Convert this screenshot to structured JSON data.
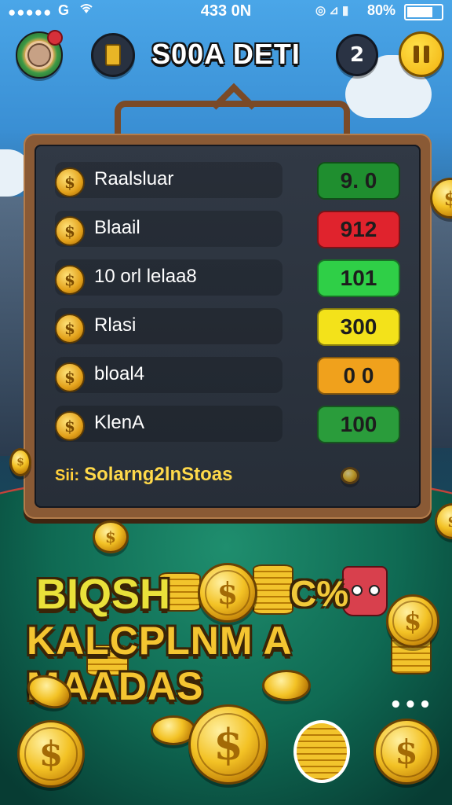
{
  "status_bar": {
    "signal": "●●●●●",
    "carrier_icon": "G",
    "wifi_icon": "wifi-icon",
    "time": "433 0N",
    "right_icons": "◎ ⊿ ▮",
    "battery_pct": "80%",
    "battery_level": 0.8
  },
  "header": {
    "title": "S00A DETI",
    "friends_label": "2",
    "avatar_icon": "avatar-icon",
    "card_icon": "card-icon",
    "pause_icon": "pause-icon"
  },
  "board": {
    "rows": [
      {
        "coin": "$",
        "label": "Raalsluar",
        "value": "9. 0",
        "color": "#1f8e2f"
      },
      {
        "coin": "$",
        "label": "Blaail",
        "value": "912",
        "color": "#e0232d"
      },
      {
        "coin": "$",
        "label": "10 orl lelaa8",
        "value": "101",
        "color": "#2fcf47"
      },
      {
        "coin": "$",
        "label": "Rlasi",
        "value": "300",
        "color": "#f3e21a"
      },
      {
        "coin": "$",
        "label": "bloal4",
        "value": "0 0",
        "color": "#f0a11c"
      },
      {
        "coin": "$",
        "label": "KlenA",
        "value": "100",
        "color": "#2a9c3b"
      }
    ],
    "footer_prefix": "Sii:",
    "footer_text": "Solarng2lnStoas"
  },
  "banner": {
    "line1": "BIQSH",
    "line1_right": "C%",
    "line2": "KALCPLNM A MAADAS"
  },
  "bottom": {
    "coin_symbol": "$",
    "more_dots": "•••"
  }
}
